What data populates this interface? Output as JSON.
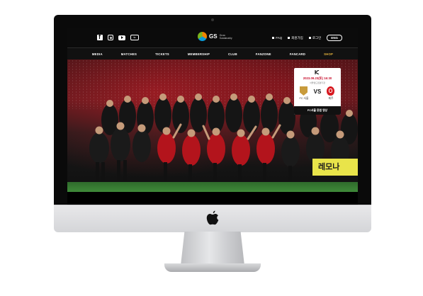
{
  "header": {
    "social_icons": [
      "facebook-icon",
      "instagram-icon",
      "youtube-icon",
      "tv-icon"
    ],
    "logo_text": "GS",
    "logo_tagline_1": "Grow",
    "logo_tagline_2": "Sustainably",
    "util_faq": "FAQ",
    "util_signup": "회원가입",
    "util_login": "로그인",
    "lang": "ENG"
  },
  "nav": {
    "items": [
      "MEDIA",
      "MATCHES",
      "TICKETS",
      "MEMBERSHIP",
      "CLUB",
      "FANZONE",
      "FANCARD",
      "SHOP"
    ]
  },
  "match": {
    "date": "2023.09.23(토) 16:30",
    "venue": "서울월드컵경기장",
    "vs": "VS",
    "home": "FC 서울",
    "away": "제주",
    "button": "FC서울 응원 영상"
  },
  "hero": {
    "banner": "레모나"
  },
  "colors": {
    "accent_red": "#c8102e",
    "shop_gold": "#e3b23c",
    "banner_yellow": "#e9e44a"
  }
}
